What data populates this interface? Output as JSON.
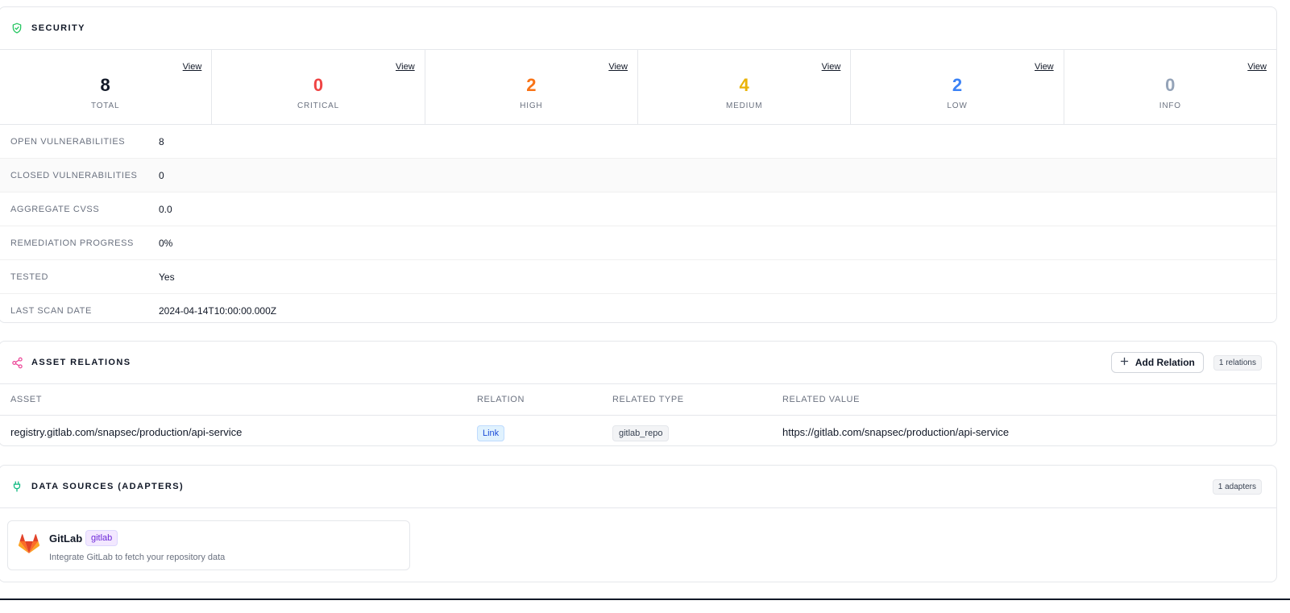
{
  "security": {
    "title": "SECURITY",
    "stats": [
      {
        "value": "8",
        "label": "TOTAL",
        "view": "View",
        "color": "#111827"
      },
      {
        "value": "0",
        "label": "CRITICAL",
        "view": "View",
        "color": "#ef4444"
      },
      {
        "value": "2",
        "label": "HIGH",
        "view": "View",
        "color": "#f97316"
      },
      {
        "value": "4",
        "label": "MEDIUM",
        "view": "View",
        "color": "#eab308"
      },
      {
        "value": "2",
        "label": "LOW",
        "view": "View",
        "color": "#3b82f6"
      },
      {
        "value": "0",
        "label": "INFO",
        "view": "View",
        "color": "#94a3b8"
      }
    ],
    "rows": [
      {
        "key": "OPEN VULNERABILITIES",
        "value": "8"
      },
      {
        "key": "CLOSED VULNERABILITIES",
        "value": "0"
      },
      {
        "key": "AGGREGATE CVSS",
        "value": "0.0"
      },
      {
        "key": "REMEDIATION PROGRESS",
        "value": "0%"
      },
      {
        "key": "TESTED",
        "value": "Yes"
      },
      {
        "key": "LAST SCAN DATE",
        "value": "2024-04-14T10:00:00.000Z"
      }
    ]
  },
  "relations": {
    "title": "ASSET RELATIONS",
    "add_label": "Add Relation",
    "count": "1 relations",
    "columns": [
      "ASSET",
      "RELATION",
      "RELATED TYPE",
      "RELATED VALUE"
    ],
    "rows": [
      {
        "asset": "registry.gitlab.com/snapsec/production/api-service",
        "relation": "Link",
        "related_type": "gitlab_repo",
        "related_value": "https://gitlab.com/snapsec/production/api-service"
      }
    ]
  },
  "adapters": {
    "title": "DATA SOURCES (ADAPTERS)",
    "count": "1 adapters",
    "items": [
      {
        "name": "GitLab",
        "tag": "gitlab",
        "description": "Integrate GitLab to fetch your repository data",
        "icon": "gitlab-logo"
      }
    ]
  },
  "colors": {
    "security_icon": "#22c55e",
    "relations_icon": "#ec4899",
    "adapters_icon": "#10b981"
  }
}
